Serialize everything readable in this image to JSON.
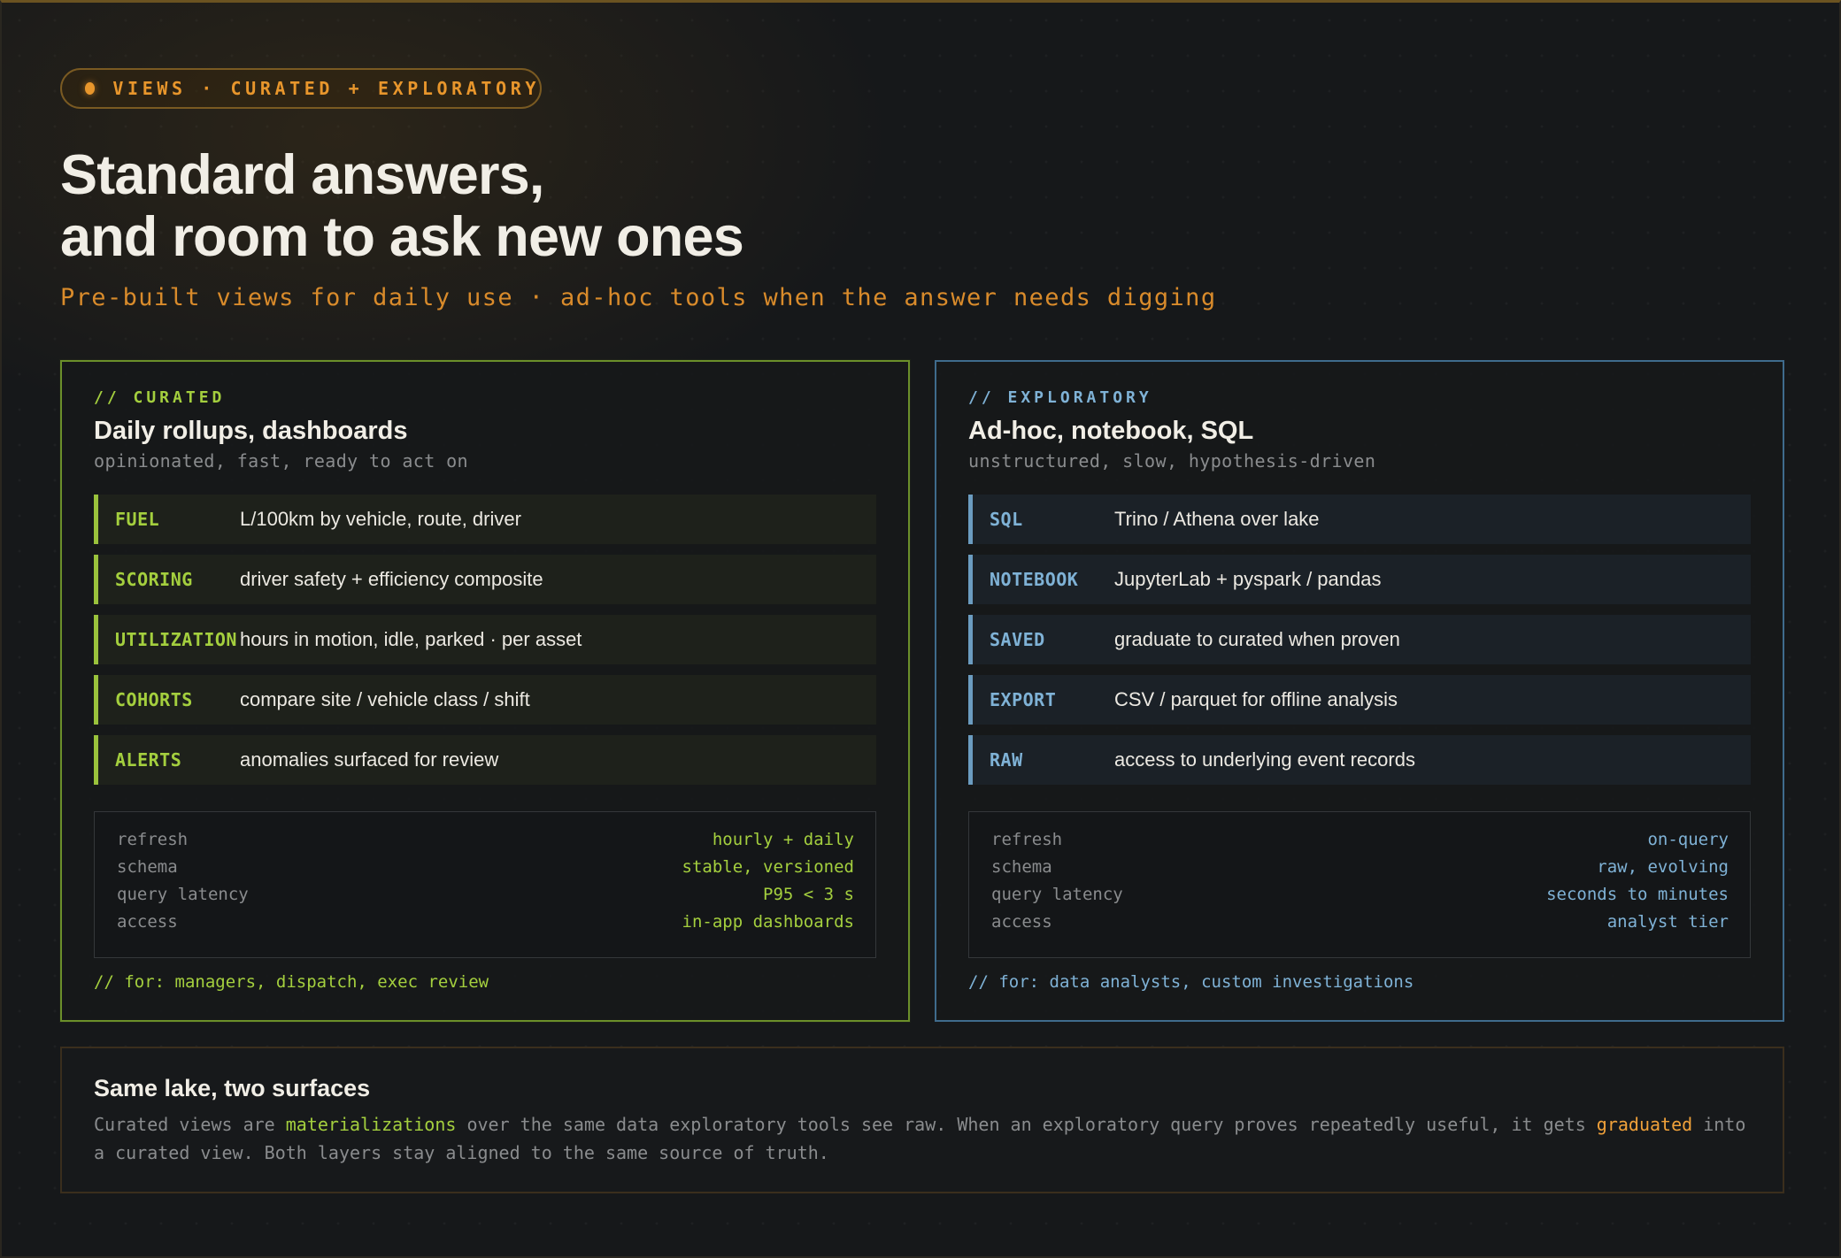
{
  "badge": {
    "text": "VIEWS · CURATED + EXPLORATORY"
  },
  "hero": {
    "title_line1": "Standard answers,",
    "title_line2": "and room to ask new ones",
    "subtitle": "Pre-built views for daily use · ad-hoc tools when the answer needs digging"
  },
  "curated": {
    "tag": "// CURATED",
    "title": "Daily rollups, dashboards",
    "subtitle": "opinionated, fast, ready to act on",
    "rows": [
      {
        "key": "FUEL",
        "value": "L/100km by vehicle, route, driver"
      },
      {
        "key": "SCORING",
        "value": "driver safety + efficiency composite"
      },
      {
        "key": "UTILIZATION",
        "value": "hours in motion, idle, parked · per asset"
      },
      {
        "key": "COHORTS",
        "value": "compare site / vehicle class / shift"
      },
      {
        "key": "ALERTS",
        "value": "anomalies surfaced for review"
      }
    ],
    "stats": [
      {
        "k": "refresh",
        "v": "hourly + daily"
      },
      {
        "k": "schema",
        "v": "stable, versioned"
      },
      {
        "k": "query latency",
        "v": "P95 < 3 s"
      },
      {
        "k": "access",
        "v": "in-app dashboards"
      }
    ],
    "footnote": "// for: managers, dispatch, exec review"
  },
  "exploratory": {
    "tag": "// EXPLORATORY",
    "title": "Ad-hoc, notebook, SQL",
    "subtitle": "unstructured, slow, hypothesis-driven",
    "rows": [
      {
        "key": "SQL",
        "value": "Trino / Athena over lake"
      },
      {
        "key": "NOTEBOOK",
        "value": "JupyterLab + pyspark / pandas"
      },
      {
        "key": "SAVED",
        "value": "graduate to curated when proven"
      },
      {
        "key": "EXPORT",
        "value": "CSV / parquet for offline analysis"
      },
      {
        "key": "RAW",
        "value": "access to underlying event records"
      }
    ],
    "stats": [
      {
        "k": "refresh",
        "v": "on-query"
      },
      {
        "k": "schema",
        "v": "raw, evolving"
      },
      {
        "k": "query latency",
        "v": "seconds to minutes"
      },
      {
        "k": "access",
        "v": "analyst tier"
      }
    ],
    "footnote": "// for: data analysts, custom investigations"
  },
  "note": {
    "title": "Same lake, two surfaces",
    "part1": "Curated views are ",
    "highlight1": "materializations",
    "part2": " over the same data exploratory tools see raw. When an exploratory query proves repeatedly useful, it gets ",
    "highlight2": "graduated",
    "part3": " into a curated view. Both layers stay aligned to the same source of truth."
  },
  "colors": {
    "curated_accent": "#a4cf3e",
    "exploratory_accent": "#7fb2d6",
    "badge_accent": "#e8962c",
    "background": "#16181a"
  }
}
